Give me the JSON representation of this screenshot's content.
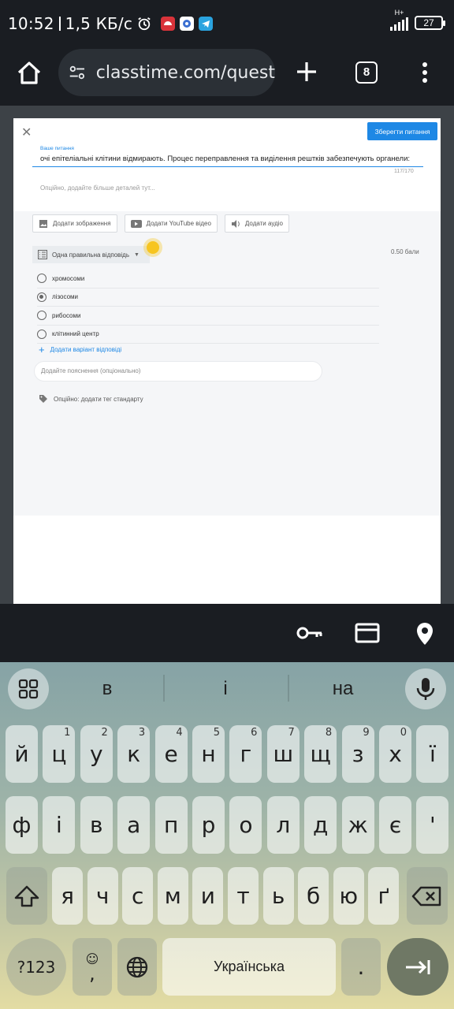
{
  "status_bar": {
    "time": "10:52",
    "speed": "1,5 КБ/с",
    "network": "H+",
    "battery": "27"
  },
  "browser": {
    "url": "classtime.com/quest",
    "tab_count": "8"
  },
  "dialog": {
    "save_label": "Зберегти питання",
    "question_label": "Ваше питання",
    "question_text": "очі епітеліальні клітини відмирають. Процес переправлення та виділення рештків забезпечують органели:",
    "char_counter": "117/170",
    "details_placeholder": "Опційно, додайте більше деталей тут...",
    "media": {
      "add_image": "Додати зображення",
      "add_youtube": "Додати YouTube відео",
      "add_audio": "Додати аудіо"
    },
    "question_type": "Одна правильна відповідь",
    "points": "0.50 бали",
    "answers": [
      {
        "label": "хромосоми",
        "selected": false
      },
      {
        "label": "лізосоми",
        "selected": true
      },
      {
        "label": "рибосоми",
        "selected": false
      },
      {
        "label": "клітинний центр",
        "selected": false
      }
    ],
    "add_answer": "Додати варіант відповіді",
    "explanation_placeholder": "Додайте пояснення (опціонально)",
    "tag_label": "Опційно: додати тег стандарту"
  },
  "keyboard": {
    "suggestions": [
      "в",
      "і",
      "на"
    ],
    "row1": [
      {
        "k": "й",
        "h": ""
      },
      {
        "k": "ц",
        "h": "1"
      },
      {
        "k": "у",
        "h": "2"
      },
      {
        "k": "к",
        "h": "3"
      },
      {
        "k": "е",
        "h": "4"
      },
      {
        "k": "н",
        "h": "5"
      },
      {
        "k": "г",
        "h": "6"
      },
      {
        "k": "ш",
        "h": "7"
      },
      {
        "k": "щ",
        "h": "8"
      },
      {
        "k": "з",
        "h": "9"
      },
      {
        "k": "х",
        "h": "0"
      },
      {
        "k": "ї",
        "h": ""
      }
    ],
    "row2": [
      "ф",
      "і",
      "в",
      "а",
      "п",
      "р",
      "о",
      "л",
      "д",
      "ж",
      "є",
      "'"
    ],
    "row3": [
      "я",
      "ч",
      "с",
      "м",
      "и",
      "т",
      "ь",
      "б",
      "ю",
      "ґ"
    ],
    "symbols_label": "?123",
    "comma_label": ",",
    "space_label": "Українська",
    "period_label": "."
  }
}
